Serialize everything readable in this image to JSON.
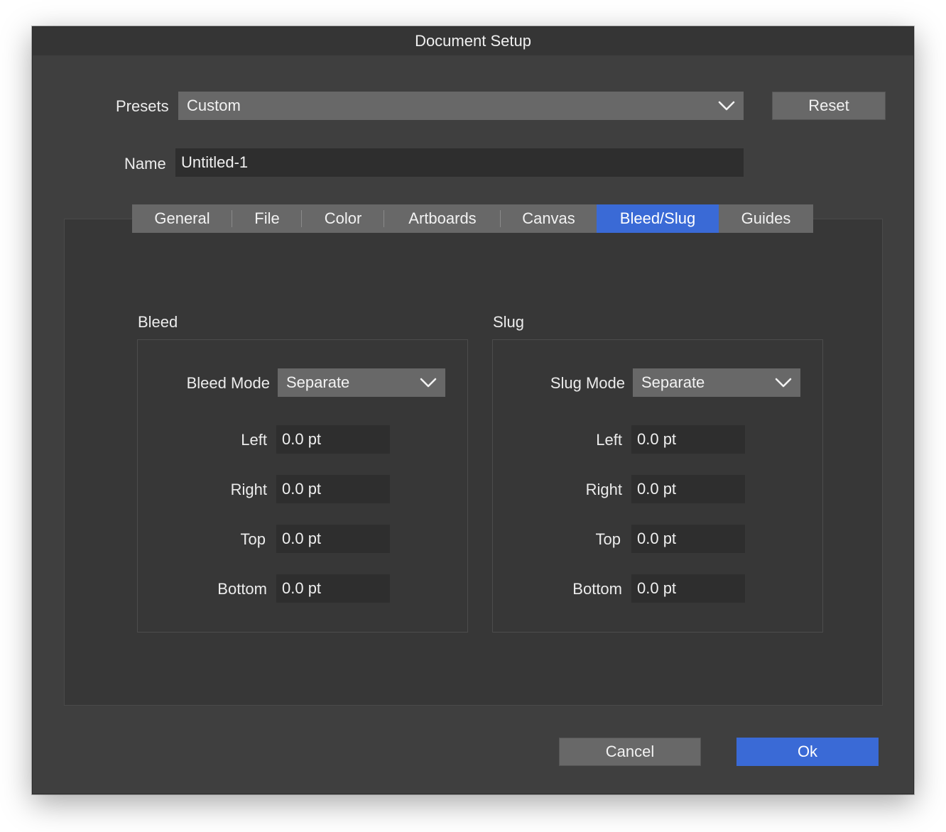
{
  "window": {
    "title": "Document Setup"
  },
  "presets": {
    "label": "Presets",
    "value": "Custom",
    "reset_label": "Reset"
  },
  "name": {
    "label": "Name",
    "value": "Untitled-1"
  },
  "tabs": [
    {
      "label": "General"
    },
    {
      "label": "File"
    },
    {
      "label": "Color"
    },
    {
      "label": "Artboards"
    },
    {
      "label": "Canvas"
    },
    {
      "label": "Bleed/Slug",
      "active": true
    },
    {
      "label": "Guides"
    }
  ],
  "bleed": {
    "title": "Bleed",
    "mode_label": "Bleed Mode",
    "mode_value": "Separate",
    "left_label": "Left",
    "left_value": "0.0 pt",
    "right_label": "Right",
    "right_value": "0.0 pt",
    "top_label": "Top",
    "top_value": "0.0 pt",
    "bottom_label": "Bottom",
    "bottom_value": "0.0 pt"
  },
  "slug": {
    "title": "Slug",
    "mode_label": "Slug Mode",
    "mode_value": "Separate",
    "left_label": "Left",
    "left_value": "0.0 pt",
    "right_label": "Right",
    "right_value": "0.0 pt",
    "top_label": "Top",
    "top_value": "0.0 pt",
    "bottom_label": "Bottom",
    "bottom_value": "0.0 pt"
  },
  "footer": {
    "cancel_label": "Cancel",
    "ok_label": "Ok"
  },
  "colors": {
    "accent": "#3a6ad6",
    "dialog_bg": "#3f3f3f",
    "panel_bg": "#373737",
    "control_bg": "#686868",
    "field_bg": "#2e2e2e"
  },
  "icons": {
    "dropdown": "chevron-down-icon"
  }
}
